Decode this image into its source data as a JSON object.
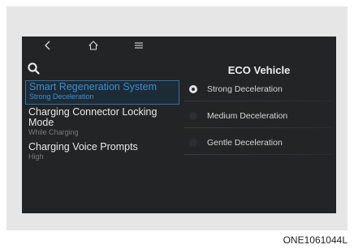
{
  "toolbar": {
    "back_icon": "chevron-left-icon",
    "home_icon": "home-icon",
    "menu_icon": "menu-icon"
  },
  "search": {
    "icon": "search-icon"
  },
  "menu": {
    "items": [
      {
        "title": "Smart Regeneration System",
        "subtitle": "Strong Deceleration",
        "selected": true
      },
      {
        "title": "Charging Connector Locking Mode",
        "subtitle": "While Charging",
        "selected": false
      },
      {
        "title": "Charging Voice Prompts",
        "subtitle": "High",
        "selected": false
      }
    ]
  },
  "panel": {
    "title": "ECO Vehicle",
    "options": [
      {
        "label": "Strong Deceleration",
        "checked": true
      },
      {
        "label": "Medium Deceleration",
        "checked": false
      },
      {
        "label": "Gentle Deceleration",
        "checked": false
      }
    ]
  },
  "colors": {
    "screen_bg": "#232426",
    "accent": "#3d8fcf",
    "frame_bg": "#e6e6e6"
  },
  "caption": "ONE1061044L"
}
